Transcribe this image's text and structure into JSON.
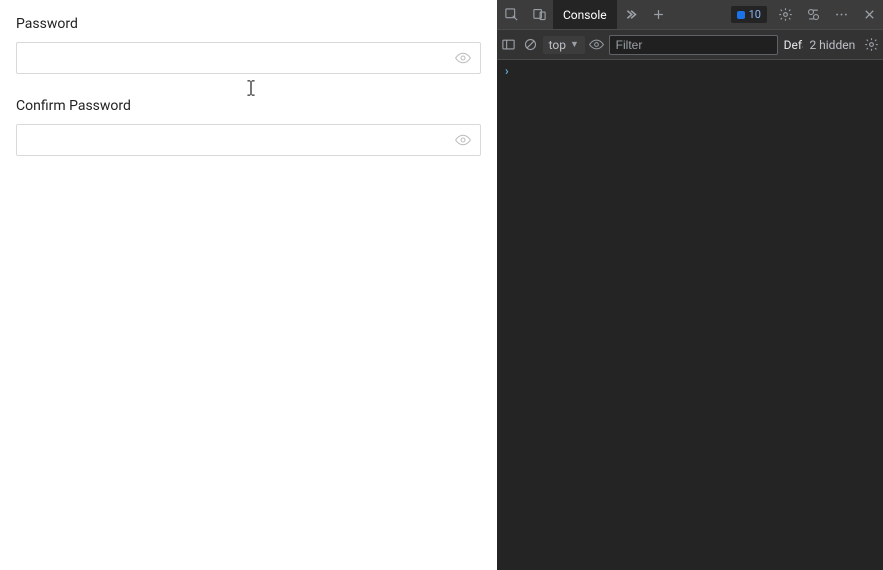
{
  "form": {
    "password_label": "Password",
    "password_value": "",
    "confirm_password_label": "Confirm Password",
    "confirm_password_value": ""
  },
  "devtools": {
    "tabs": {
      "console_label": "Console"
    },
    "issue_count": "10",
    "controls": {
      "context_label": "top",
      "filter_placeholder": "Filter",
      "level_label": "Defa",
      "hidden_text": "2 hidden"
    }
  }
}
